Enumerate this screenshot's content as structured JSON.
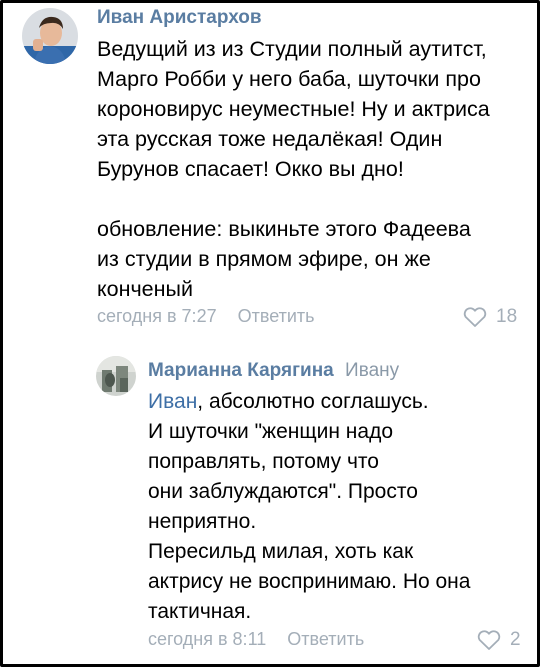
{
  "comments": [
    {
      "author": "Иван Аристархов",
      "lines": [
        "Ведущий из из Студии полный аутитст,",
        "Марго Робби у него баба, шуточки про",
        "короновирус неуместные! Ну и актриса",
        "эта русская тоже недалёкая! Один",
        "Бурунов спасает! Окко вы дно!",
        "",
        "обновление: выкиньте этого Фадеева",
        "из студии в прямом эфире, он же",
        "конченый"
      ],
      "time": "сегодня в 7:27",
      "reply_label": "Ответить",
      "likes": "18"
    }
  ],
  "reply": {
    "author": "Марианна Карягина",
    "reply_to": "Ивану",
    "mention": "Иван",
    "first_line_rest": ", абсолютно соглашусь.",
    "lines": [
      "И шуточки \"женщин надо",
      "поправлять, потому что",
      "они заблуждаются\". Просто",
      "неприятно.",
      "Пересильд милая, хоть как",
      "актрису не воспринимаю. Но она",
      "тактичная."
    ],
    "time": "сегодня в 8:11",
    "reply_label": "Ответить",
    "likes": "2"
  },
  "colors": {
    "author": "#5a7da2",
    "meta": "#a4aeb8",
    "mention": "#3e6fa6"
  },
  "icons": {
    "like": "heart-outline-icon"
  }
}
